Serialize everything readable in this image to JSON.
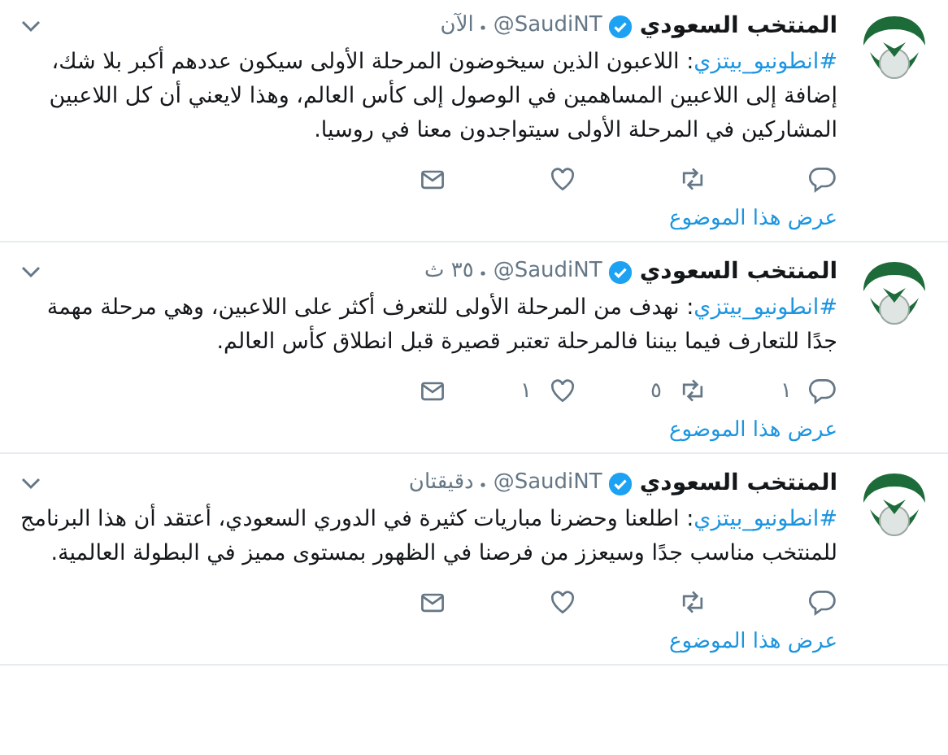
{
  "tweets": [
    {
      "name": "المنتخب السعودي",
      "verified": true,
      "handle": "@SaudiNT",
      "time": "الآن",
      "hashtag": "#انطونيو_بيتزي",
      "text": ": اللاعبون الذين سيخوضون المرحلة الأولى سيكون عددهم أكبر بلا شك، إضافة إلى اللاعبين المساهمين في الوصول إلى كأس العالم، وهذا لايعني أن كل اللاعبين المشاركين في المرحلة الأولى سيتواجدون معنا في روسيا.",
      "actions": [
        {
          "kind": "reply"
        },
        {
          "kind": "retweet"
        },
        {
          "kind": "like"
        },
        {
          "kind": "message"
        }
      ],
      "thread_link": "عرض هذا الموضوع"
    },
    {
      "name": "المنتخب السعودي",
      "verified": true,
      "handle": "@SaudiNT",
      "time": "٣٥ ث",
      "hashtag": "#انطونيو_بيتزي",
      "text": ": نهدف من المرحلة الأولى للتعرف أكثر على اللاعبين، وهي مرحلة مهمة جدًا للتعارف فيما بيننا فالمرحلة تعتبر قصيرة قبل انطلاق كأس العالم.",
      "actions": [
        {
          "kind": "reply",
          "count": "١"
        },
        {
          "kind": "retweet",
          "count": "٥"
        },
        {
          "kind": "like",
          "count": "١"
        },
        {
          "kind": "message"
        }
      ],
      "thread_link": "عرض هذا الموضوع"
    },
    {
      "name": "المنتخب السعودي",
      "verified": true,
      "handle": "@SaudiNT",
      "time": "دقيقتان",
      "hashtag": "#انطونيو_بيتزي",
      "text": ": اطلعنا وحضرنا مباريات كثيرة في الدوري السعودي، أعتقد أن هذا البرنامج للمنتخب مناسب جدًا وسيعزز من فرصنا في الظهور بمستوى مميز في البطولة العالمية.",
      "actions": [
        {
          "kind": "reply"
        },
        {
          "kind": "retweet"
        },
        {
          "kind": "like"
        },
        {
          "kind": "message"
        }
      ],
      "thread_link": "عرض هذا الموضوع"
    }
  ]
}
